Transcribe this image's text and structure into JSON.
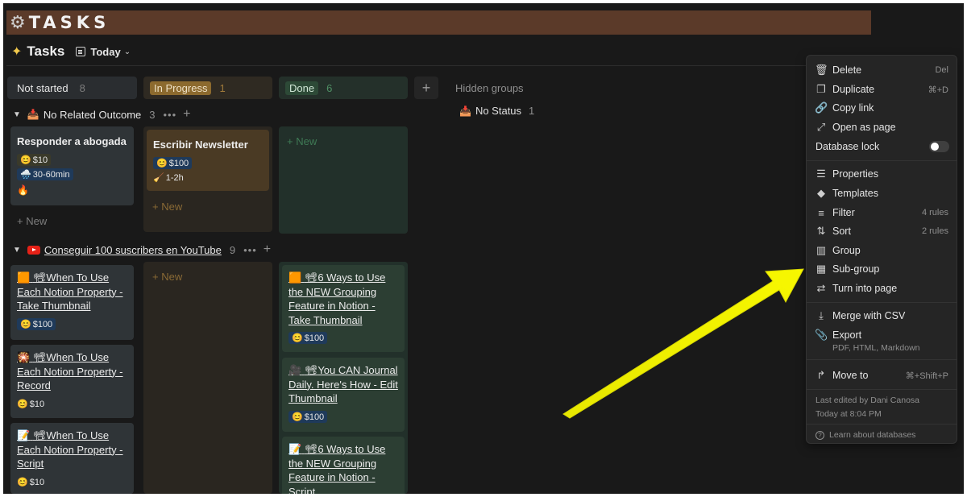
{
  "banner": {
    "icon": "gear-icon",
    "title": "TASKS"
  },
  "header": {
    "db_icon": "sparkle-icon",
    "title": "Tasks",
    "view_icon": "table-view-icon",
    "view_name": "Today"
  },
  "columns": [
    {
      "label": "Not started",
      "count": "8",
      "color": "#2a2d30"
    },
    {
      "label": "In Progress",
      "count": "1",
      "color": "#2f2a22",
      "pill": "#8c6a2e"
    },
    {
      "label": "Done",
      "count": "6",
      "color": "#24302a",
      "pill": "#2d4a37"
    }
  ],
  "hidden_groups": {
    "label": "Hidden groups",
    "no_status_label": "No Status",
    "no_status_count": "1"
  },
  "groups": [
    {
      "name": "No Related Outcome",
      "count": "3",
      "cards_not_started": [
        {
          "title": "Responder a abogada",
          "tags": [
            {
              "emoji": "😊",
              "text": "$10"
            },
            {
              "emoji": "🌧️",
              "text": "30-60min"
            }
          ],
          "extra": "🔥"
        }
      ],
      "cards_in_progress": [
        {
          "title": "Escribir Newsletter",
          "tags": [
            {
              "emoji": "😊",
              "text": "$100"
            },
            {
              "emoji": "🧹",
              "text": "1-2h"
            }
          ]
        }
      ],
      "new_label": "New"
    },
    {
      "name": "Conseguir 100 suscribers en YouTube",
      "count": "9",
      "cards_not_started": [
        {
          "icon": "🟧",
          "title": "When To Use Each Notion Property - Take Thumbnail",
          "tag": {
            "emoji": "😊",
            "text": "$100"
          }
        },
        {
          "icon": "🎇",
          "title": "When To Use Each Notion Property - Record",
          "tag": {
            "emoji": "😊",
            "text": "$10"
          }
        },
        {
          "icon": "📝",
          "title": "When To Use Each Notion Property - Script",
          "tag": {
            "emoji": "😊",
            "text": "$10"
          }
        }
      ],
      "cards_done": [
        {
          "icon": "🟧",
          "title": "6 Ways to Use the NEW Grouping Feature in Notion - Take Thumbnail",
          "tag": {
            "emoji": "😊",
            "text": "$100"
          }
        },
        {
          "icon": "🎥",
          "title": "You CAN Journal Daily. Here's How - Edit Thumbnail",
          "tag": {
            "emoji": "😊",
            "text": "$100"
          }
        },
        {
          "icon": "📝",
          "title": "6 Ways to Use the NEW Grouping Feature in Notion - Script"
        }
      ],
      "new_label": "New"
    }
  ],
  "menu": {
    "items": [
      {
        "icon": "trash-icon",
        "label": "Delete",
        "shortcut": "Del"
      },
      {
        "icon": "duplicate-icon",
        "label": "Duplicate",
        "shortcut": "⌘+D"
      },
      {
        "icon": "link-icon",
        "label": "Copy link"
      },
      {
        "icon": "expand-icon",
        "label": "Open as page"
      },
      {
        "label": "Database lock",
        "toggle": false
      },
      {
        "icon": "list-icon",
        "label": "Properties"
      },
      {
        "icon": "templates-icon",
        "label": "Templates"
      },
      {
        "icon": "filter-icon",
        "label": "Filter",
        "shortcut": "4 rules"
      },
      {
        "icon": "sort-icon",
        "label": "Sort",
        "shortcut": "2 rules"
      },
      {
        "icon": "group-icon",
        "label": "Group"
      },
      {
        "icon": "subgroup-icon",
        "label": "Sub-group"
      },
      {
        "icon": "turn-into-icon",
        "label": "Turn into page"
      },
      {
        "icon": "merge-icon",
        "label": "Merge with CSV"
      },
      {
        "icon": "export-icon",
        "label": "Export",
        "sub": "PDF, HTML, Markdown"
      },
      {
        "icon": "move-icon",
        "label": "Move to",
        "shortcut": "⌘+Shift+P"
      }
    ],
    "footer_edited": "Last edited by Dani Canosa",
    "footer_time": "Today at 8:04 PM",
    "learn_icon": "help-icon",
    "learn_label": "Learn about databases"
  },
  "annotation": {
    "arrow_color": "#f5f500",
    "icon": "yellow-arrow-icon"
  }
}
